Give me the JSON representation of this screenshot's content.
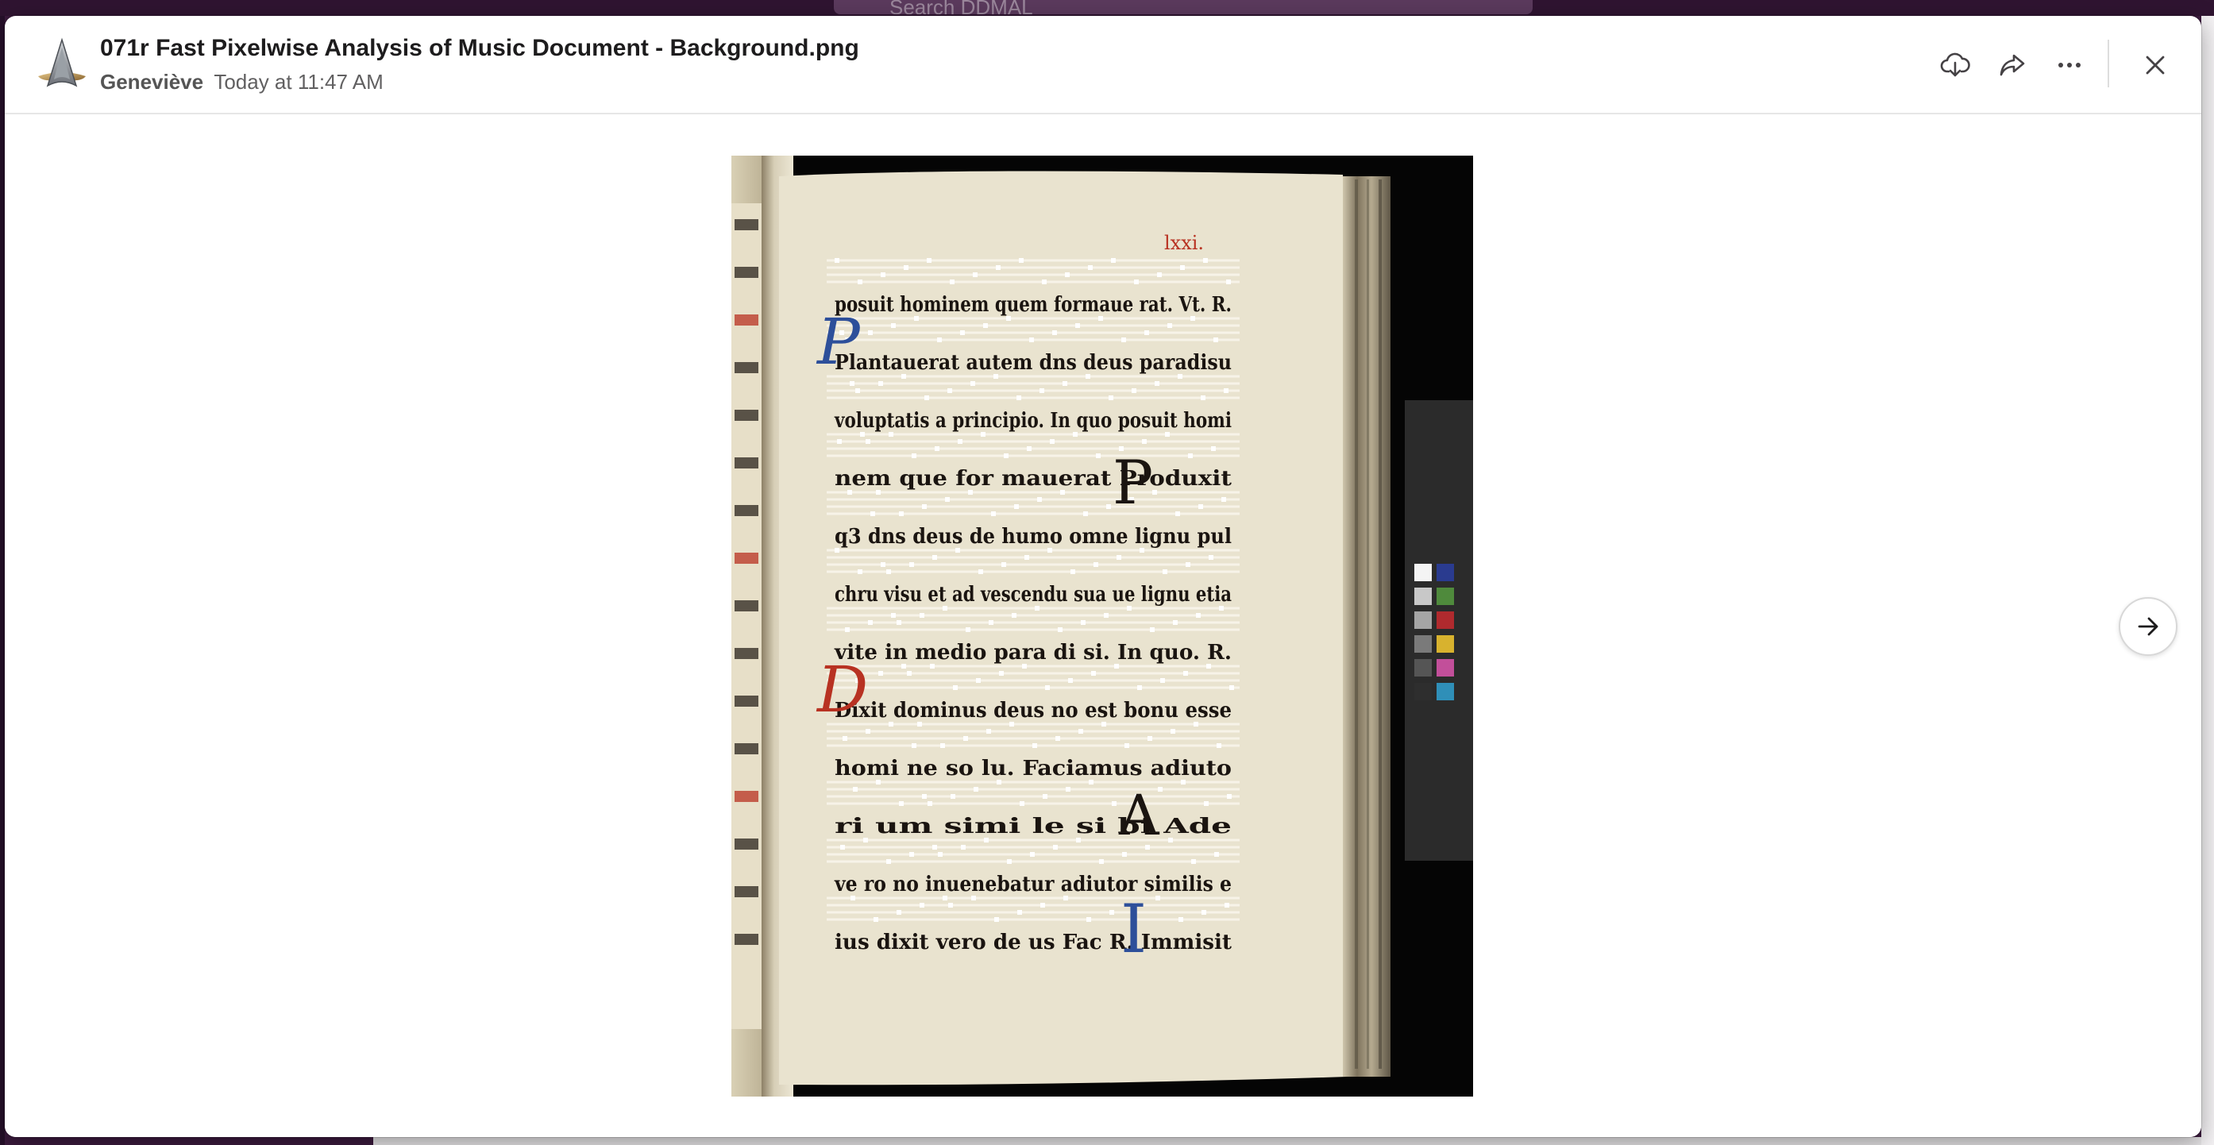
{
  "background": {
    "search_placeholder": "Search DDMAL"
  },
  "header": {
    "title": "071r Fast Pixelwise Analysis of Music Document - Background.png",
    "author": "Geneviève",
    "timestamp": "Today at 11:47 AM",
    "avatar_icon": "starfleet-badge-icon",
    "actions": {
      "download_icon": "download-icon",
      "share_icon": "share-icon",
      "more_icon": "more-actions-icon",
      "close_icon": "close-icon"
    }
  },
  "viewer": {
    "image_alt": "Manuscript page (folio 071r) with background layer of music document",
    "folio_number": "lxxi.",
    "text_lines": [
      "posuit hominem quem formaue rat. Vt. R.",
      "Plantauerat autem dns deus paradisu",
      "voluptatis a principio. In quo posuit homi",
      "nem que for mauerat Produxit",
      "q3 dns deus de humo omne lignu pul",
      "chru visu et ad vescendu sua ue lignu etia",
      "vite in medio para di si. In quo. R.",
      "Dixit dominus deus no est bonu esse",
      "homi ne so lu. Faciamus adiuto",
      "ri um simi le si bi Ade",
      "ve ro no inuenebatur adiutor similis e",
      "ius dixit vero de us Fac R. Immisit"
    ],
    "next_icon": "arrow-right-icon"
  },
  "colors": {
    "modal_bg": "#ffffff",
    "backdrop": "#3c1b3e",
    "title_text": "#1d1c1d",
    "meta_text": "#616061",
    "icon": "#454245",
    "page_parchment": "#e8e1cc",
    "ink": "#1a1410",
    "rubric_red": "#b83222",
    "initial_blue": "#2d4f9a"
  }
}
